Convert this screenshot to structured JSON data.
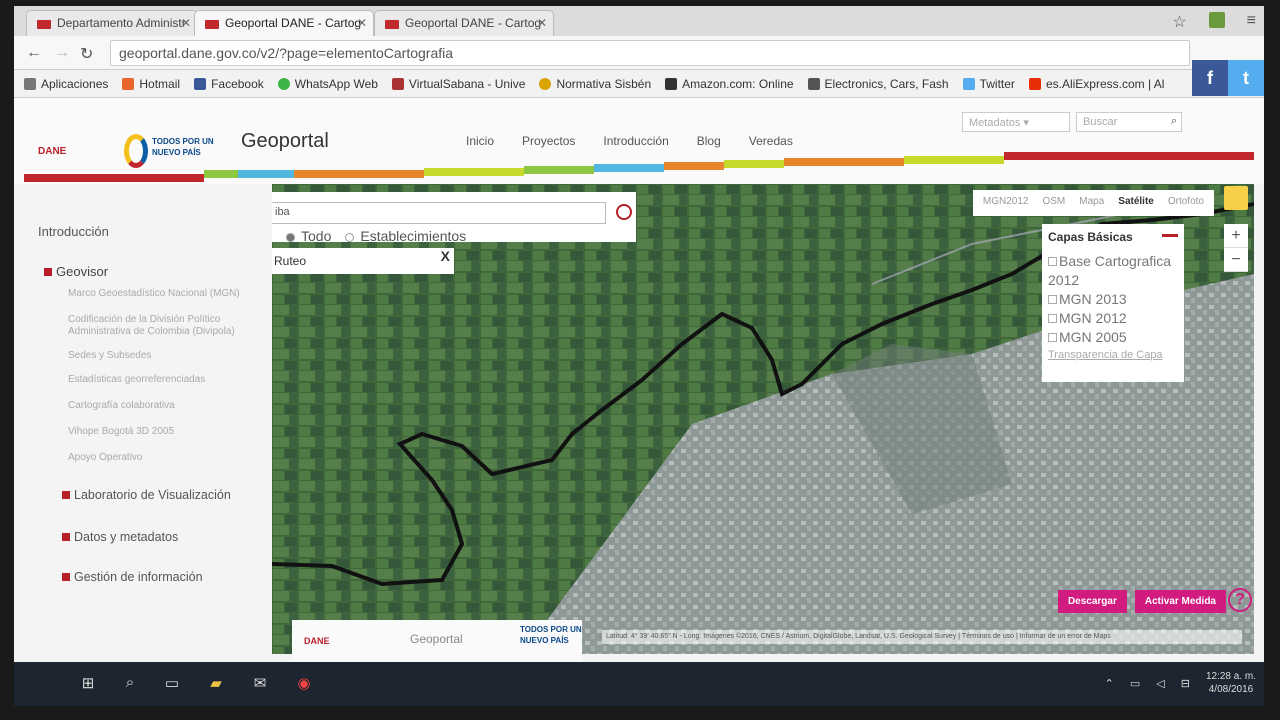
{
  "browser": {
    "tabs": [
      {
        "title": "Departamento Administr",
        "active": false
      },
      {
        "title": "Geoportal DANE - Cartog",
        "active": true
      },
      {
        "title": "Geoportal DANE - Cartog",
        "active": false
      }
    ],
    "url": "geoportal.dane.gov.co/v2/?page=elementoCartografia",
    "bookmarks": [
      "Aplicaciones",
      "Hotmail",
      "Facebook",
      "WhatsApp Web",
      "VirtualSabana - Unive",
      "Normativa Sisbén",
      "Amazon.com: Online",
      "Electronics, Cars, Fash",
      "Twitter",
      "es.AliExpress.com | Al"
    ]
  },
  "social": {
    "facebook": "f",
    "twitter": "t"
  },
  "header": {
    "dane_logo": "DANE",
    "np_logo": "TODOS POR UN NUEVO PAÍS",
    "brand": "Geoportal",
    "menu": [
      "Inicio",
      "Proyectos",
      "Introducción",
      "Blog",
      "Veredas"
    ],
    "metadata_select": "Metadatos",
    "search_placeholder": "Buscar"
  },
  "sidebar": {
    "intro": "Introducción",
    "geovisor": "Geovisor",
    "sub_items": [
      "Marco Geoestadístico Nacional (MGN)",
      "Codificación de la División Político Administrativa de Colombia (Divipola)",
      "Sedes y Subsedes",
      "Estadísticas georreferenciadas",
      "Cartografía colaborativa",
      "Vihope Bogotá 3D 2005",
      "Apoyo Operativo"
    ],
    "sections": [
      "Laboratorio de Visualización",
      "Datos y metadatos",
      "Gestión de información"
    ]
  },
  "map": {
    "search_value": "iba",
    "radio_all": "Todo",
    "radio_est": "Establecimientos",
    "ruteo": "Ruteo",
    "ruteo_close": "X",
    "base_layers": [
      "MGN2012",
      "OSM",
      "Mapa",
      "Satélite",
      "Ortofoto"
    ],
    "active_base": "Satélite",
    "zoom_in": "+",
    "zoom_out": "−",
    "layers_title": "Capas Básicas",
    "layers": [
      "Base Cartografica 2012",
      "MGN 2013",
      "MGN 2012",
      "MGN 2005"
    ],
    "transparency": "Transparencia de Capa",
    "download": "Descargar",
    "measure": "Activar Medida",
    "help": "?",
    "attribution": "Latitud: 4° 39' 40.65\" N - Long: Imágenes ©2016, CNES / Astrium, DigitalGlobe, Landsat, U.S. Geological Survey | Términos de uso | Informar de un error de Maps"
  },
  "footer": {
    "dane": "DANE",
    "geoportal": "Geoportal",
    "np": "TODOS POR UN NUEVO PAÍS"
  },
  "taskbar": {
    "time": "12:28 a. m.",
    "date": "4/08/2016"
  }
}
